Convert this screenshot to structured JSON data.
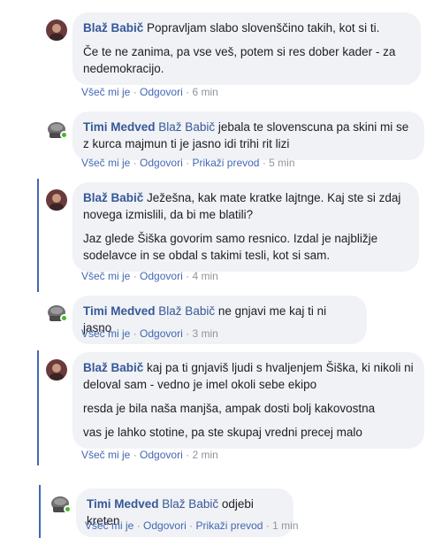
{
  "comments": [
    {
      "author": "Blaž Babič",
      "mention": "",
      "paragraphs": [
        "Popravljam slabo slovenščino takih, kot si ti.",
        "Če te ne zanima, pa vse veš, potem si res dober kader - za nedemokracijo."
      ],
      "like": "Všeč mi je",
      "reply": "Odgovori",
      "translate": "",
      "time": "6 min",
      "avatar": "blaz-avatar"
    },
    {
      "author": "Timi Medved",
      "mention": "Blaž Babič",
      "paragraphs": [
        "jebala te slovenscuna pa skini mi se z kurca majmun ti je jasno idi trihi rit lizi"
      ],
      "like": "Všeč mi je",
      "reply": "Odgovori",
      "translate": "Prikaži prevod",
      "time": "5 min",
      "avatar": "timi-avatar"
    },
    {
      "author": "Blaž Babič",
      "mention": "",
      "paragraphs": [
        "Ježešna, kak mate kratke lajtnge. Kaj ste si zdaj novega izmislili, da bi me blatili?",
        "Jaz glede Šiška govorim samo resnico. Izdal je najbližje sodelavce in se obdal s takimi tesli, kot si sam."
      ],
      "like": "Všeč mi je",
      "reply": "Odgovori",
      "translate": "",
      "time": "4 min",
      "avatar": "blaz-avatar"
    },
    {
      "author": "Timi Medved",
      "mention": "Blaž Babič",
      "paragraphs": [
        "ne gnjavi me kaj ti ni jasno"
      ],
      "like": "Všeč mi je",
      "reply": "Odgovori",
      "translate": "",
      "time": "3 min",
      "avatar": "timi-avatar"
    },
    {
      "author": "Blaž Babič",
      "mention": "",
      "paragraphs": [
        "kaj pa ti gnjaviš ljudi s hvaljenjem Šiška, ki nikoli ni deloval sam - vedno je imel okoli sebe ekipo",
        "resda je bila naša manjša, ampak dosti bolj kakovostna",
        "vas je lahko stotine, pa ste skupaj vredni precej malo"
      ],
      "like": "Všeč mi je",
      "reply": "Odgovori",
      "translate": "",
      "time": "2 min",
      "avatar": "blaz-avatar"
    },
    {
      "author": "Timi Medved",
      "mention": "Blaž Babič",
      "paragraphs": [
        "odjebi kreten"
      ],
      "like": "Všeč mi je",
      "reply": "Odgovori",
      "translate": "Prikaži prevod",
      "time": "1 min",
      "avatar": "timi-avatar"
    }
  ],
  "colors": {
    "link": "#365899",
    "action_link": "#4267b2",
    "bubble_bg": "#f0f2f5",
    "meta": "#90949c",
    "online": "#42b72a",
    "thread_bar": "#4267b2"
  }
}
